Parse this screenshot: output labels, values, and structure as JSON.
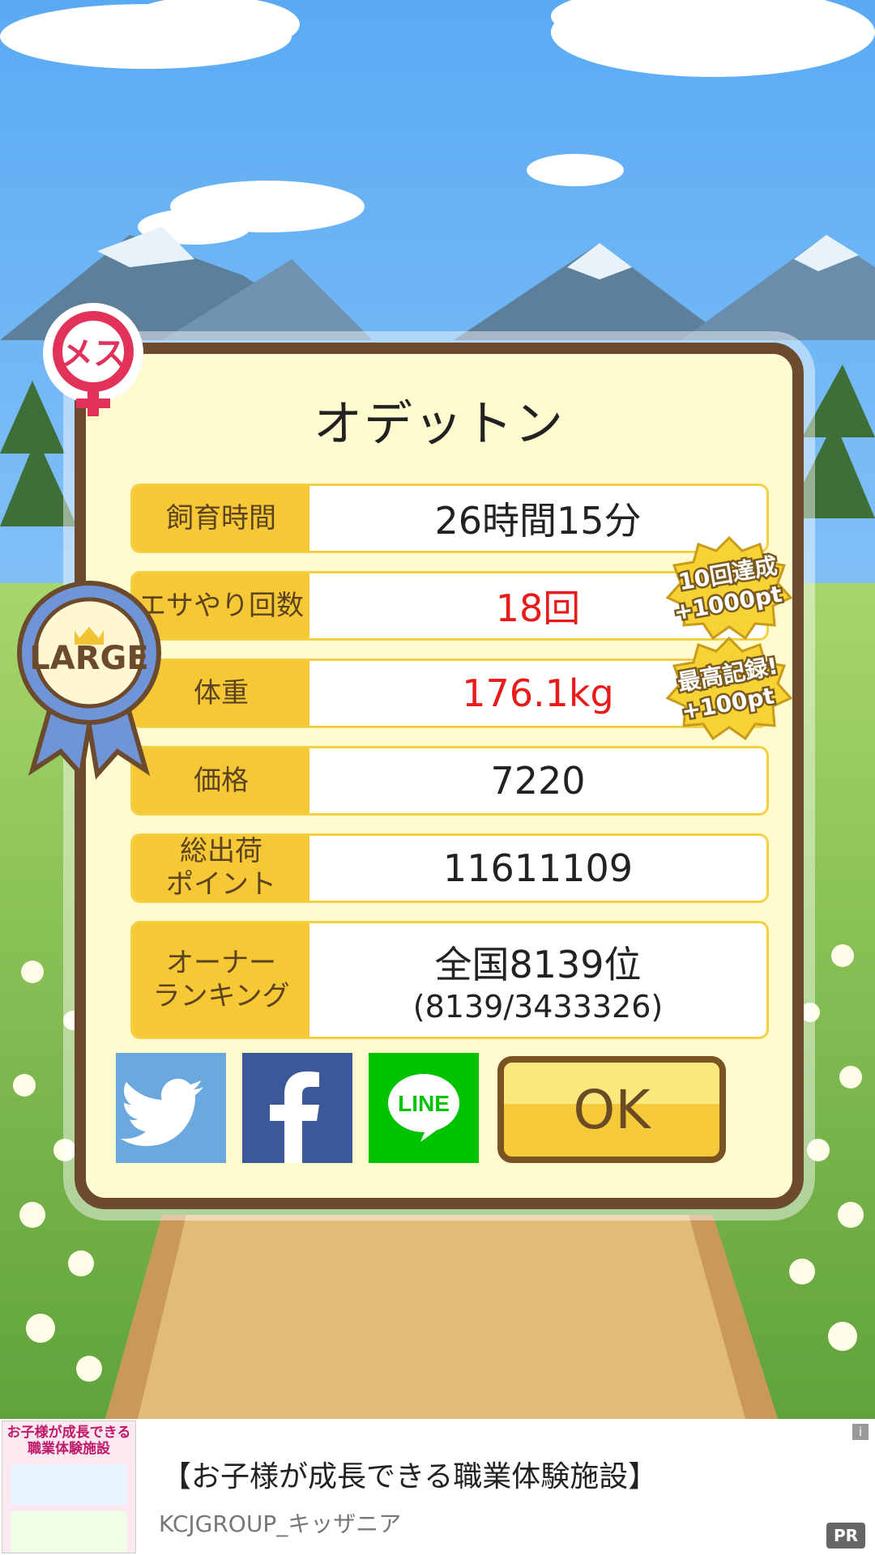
{
  "pig": {
    "name": "オデットン",
    "gender_label": "メス",
    "size_badge": "LARGE"
  },
  "stats": [
    {
      "label": "飼育時間",
      "value": "26時間15分",
      "highlight": false
    },
    {
      "label": "エサやり回数",
      "value": "18回",
      "highlight": true
    },
    {
      "label": "体重",
      "value": "176.1kg",
      "highlight": true
    },
    {
      "label": "価格",
      "value": "7220",
      "highlight": false
    },
    {
      "label": "総出荷\nポイント",
      "value": "11611109",
      "highlight": false
    }
  ],
  "ranking": {
    "label": "オーナー\nランキング",
    "line1": "全国8139位",
    "line2": "(8139/3433326)"
  },
  "bonus_badges": [
    {
      "line1": "10回達成",
      "line2": "+1000pt"
    },
    {
      "line1": "最高記録!",
      "line2": "+100pt"
    }
  ],
  "share": {
    "twitter": "twitter",
    "facebook": "f",
    "line": "LINE"
  },
  "ok_label": "OK",
  "ad": {
    "title": "【お子様が成長できる職業体験施設】",
    "sponsor": "KCJGROUP_キッザニア",
    "thumb_text": "お子様が成長できる職業体験施設",
    "pr": "PR",
    "info": "i"
  },
  "colors": {
    "accent": "#f7c836",
    "frame": "#6b4a2d",
    "highlight": "#e81b1b",
    "twitter": "#6aa8de",
    "facebook": "#3b5998",
    "line": "#00c300"
  }
}
